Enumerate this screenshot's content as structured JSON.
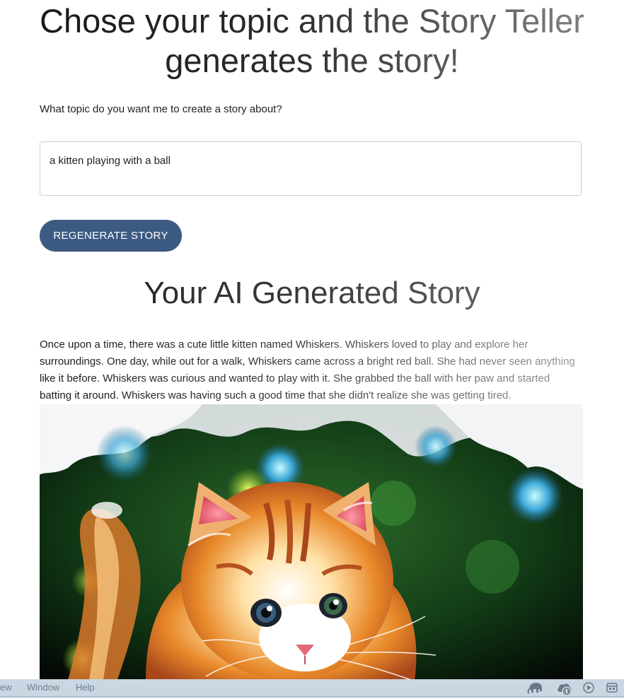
{
  "header": {
    "title_line1": "Chose your topic and the Story Teller",
    "title_line2": "generates the story!"
  },
  "form": {
    "prompt_label": "What topic do you want me to create a story about?",
    "topic_value": "a kitten playing with a ball",
    "regenerate_label": "REGENERATE STORY"
  },
  "story": {
    "heading": "Your AI Generated Story",
    "text": "Once upon a time, there was a cute little kitten named Whiskers. Whiskers loved to play and explore her surroundings. One day, while out for a walk, Whiskers came across a bright red ball. She had never seen anything like it before. Whiskers was curious and wanted to play with it. She grabbed the ball with her paw and started batting it around. Whiskers was having such a good time that she didn't realize she was getting tired."
  },
  "menubar": {
    "items": [
      "ew",
      "Window",
      "Help"
    ],
    "tray_icons": [
      "elephant-icon",
      "cloud-sync-icon",
      "play-icon",
      "calendar-icon"
    ]
  },
  "colors": {
    "button_bg": "#3c5a82",
    "menubar_bg": "#c9d7e3"
  }
}
